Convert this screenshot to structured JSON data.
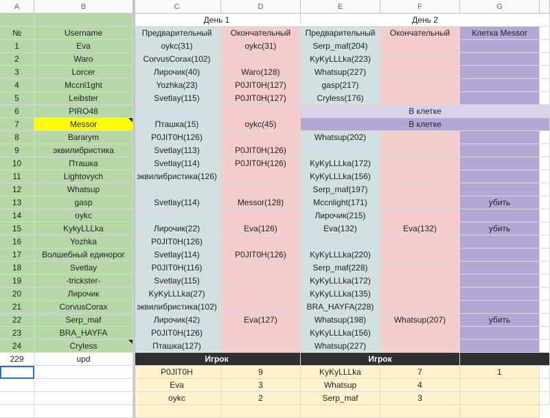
{
  "columns": [
    "A",
    "B",
    "C",
    "D",
    "E",
    "F",
    "G"
  ],
  "days": {
    "day1": "День 1",
    "day2": "День 2"
  },
  "headers": {
    "num": "№",
    "username": "Username",
    "pre1": "Предварительный",
    "fin1": "Окончательный",
    "pre2": "Предварительный",
    "fin2": "Окончательный",
    "cage": "Клетка Messor"
  },
  "rows": [
    {
      "n": "1",
      "user": "Eva",
      "c": "oykc(31)",
      "d": "oykc(31)",
      "e": "Serp_maf(204)",
      "f": "",
      "g": ""
    },
    {
      "n": "2",
      "user": "Waro",
      "c": "CorvusCorax(102)",
      "d": "",
      "e": "KyKyLLLka(223)",
      "f": "",
      "g": ""
    },
    {
      "n": "3",
      "user": "Lorcer",
      "c": "Лирочик(40)",
      "d": "Waro(128)",
      "e": "Whatsup(227)",
      "f": "",
      "g": ""
    },
    {
      "n": "4",
      "user": "Mccnl1ght",
      "c": "Yozhka(23)",
      "d": "P0JIT0H(127)",
      "e": "gasp(217)",
      "f": "",
      "g": ""
    },
    {
      "n": "5",
      "user": "Leibster",
      "c": "Svetlay(115)",
      "d": "P0JIT0H(127)",
      "e": "Cryless(176)",
      "f": "",
      "g": ""
    },
    {
      "n": "6",
      "user": "PIRO48",
      "c": "",
      "d": "",
      "merged": "В клетке"
    },
    {
      "n": "7",
      "user": "Messor",
      "c": "Пташка(15)",
      "d": "oykc(45)",
      "merged": "В клетке"
    },
    {
      "n": "8",
      "user": "Bararym",
      "c": "P0JIT0H(126)",
      "d": "",
      "e": "Whatsup(202)",
      "f": "",
      "g": ""
    },
    {
      "n": "9",
      "user": "эквилибристика",
      "c": "Svetlay(113)",
      "d": "P0JIT0H(126)",
      "e": "",
      "f": "",
      "g": ""
    },
    {
      "n": "10",
      "user": "Пташка",
      "c": "Svetlay(114)",
      "d": "P0JIT0H(126)",
      "e": "KyKyLLLka(172)",
      "f": "",
      "g": ""
    },
    {
      "n": "11",
      "user": "Lightovych",
      "c": "эквилибристика(126)",
      "d": "",
      "e": "KyKyLLLka(156)",
      "f": "",
      "g": ""
    },
    {
      "n": "12",
      "user": "Whatsup",
      "c": "",
      "d": "",
      "e": "Serp_maf(197)",
      "f": "",
      "g": ""
    },
    {
      "n": "13",
      "user": "gasp",
      "c": "Svetlay(114)",
      "d": "Messor(128)",
      "e": "Mccnlight(171)",
      "f": "",
      "g": "убить"
    },
    {
      "n": "14",
      "user": "oykc",
      "c": "",
      "d": "",
      "e": "Лирочик(215)",
      "f": "",
      "g": ""
    },
    {
      "n": "15",
      "user": "KykyLLLka",
      "c": "Лирочик(22)",
      "d": "Eva(126)",
      "e": "Eva(132)",
      "f": "Eva(132)",
      "g": "убить"
    },
    {
      "n": "16",
      "user": "Yozhka",
      "c": "P0JIT0H(126)",
      "d": "",
      "e": "",
      "f": "",
      "g": ""
    },
    {
      "n": "17",
      "user": "Волшебный единорог",
      "c": "Svetlay(114)",
      "d": "P0JIT0H(126)",
      "e": "KyKyLLLka(220)",
      "f": "",
      "g": ""
    },
    {
      "n": "18",
      "user": "Svetlay",
      "c": "P0JIT0H(116)",
      "d": "",
      "e": "Serp_maf(228)",
      "f": "",
      "g": ""
    },
    {
      "n": "19",
      "user": "-trickster-",
      "c": "Svetlay(115)",
      "d": "",
      "e": "KyKyLLLka(172)",
      "f": "",
      "g": ""
    },
    {
      "n": "20",
      "user": "Лирочик",
      "c": "KyKyLLLka(27)",
      "d": "",
      "e": "KyKyLLLka(135)",
      "f": "",
      "g": ""
    },
    {
      "n": "21",
      "user": "CorvusCorax",
      "c": "эквилибристика(102)",
      "d": "",
      "e": "BRA_HAYFA(228)",
      "f": "",
      "g": ""
    },
    {
      "n": "22",
      "user": "Serp_maf",
      "c": "Лирочик(42)",
      "d": "Eva(127)",
      "e": "Whatsup(198)",
      "f": "Whatsup(207)",
      "g": "убить"
    },
    {
      "n": "23",
      "user": "BRA_HAYFA",
      "c": "P0JIT0H(126)",
      "d": "",
      "e": "KyKyLLLka(156)",
      "f": "",
      "g": ""
    },
    {
      "n": "24",
      "user": "Cryless",
      "c": "Пташка(127)",
      "d": "",
      "e": "Whatsup(227)",
      "f": "",
      "g": ""
    }
  ],
  "footer": {
    "a": "229",
    "b": "upd",
    "player1": "Игрок",
    "player2": "Игрок"
  },
  "summary": [
    {
      "c": "P0JIT0H",
      "d": "9",
      "e": "KyKyLLLka",
      "f": "7",
      "g": "1"
    },
    {
      "c": "Eva",
      "d": "3",
      "e": "Whatsup",
      "f": "4",
      "g": ""
    },
    {
      "c": "oykc",
      "d": "2",
      "e": "Serp_maf",
      "f": "3",
      "g": ""
    }
  ],
  "colors": {
    "green": "#b6d7a8",
    "blue": "#d0e0e3",
    "pink": "#f4cccc",
    "purple": "#b4a7d6",
    "lavender": "#d9d2e9",
    "purpleMerged": "#b4a7d6",
    "yellow": "#ffff00",
    "darkbar": "#303030",
    "cream": "#fff2cc"
  }
}
